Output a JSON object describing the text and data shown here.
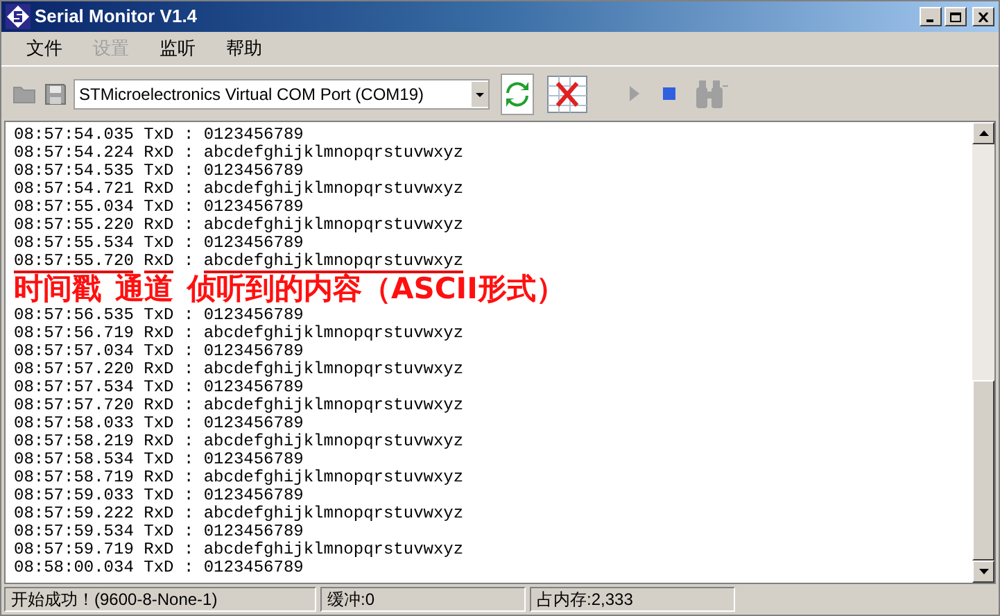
{
  "window": {
    "title": "Serial Monitor V1.4"
  },
  "menu": [
    {
      "label": "文件",
      "disabled": false
    },
    {
      "label": "设置",
      "disabled": true
    },
    {
      "label": "监听",
      "disabled": false
    },
    {
      "label": "帮助",
      "disabled": false
    }
  ],
  "toolbar": {
    "left": [
      {
        "kind": "folder",
        "disabled": true
      },
      {
        "kind": "save",
        "disabled": true
      }
    ],
    "port": {
      "value": "STMicroelectronics Virtual COM Port (COM19)"
    },
    "right": [
      {
        "kind": "refresh",
        "disabled": false
      },
      {
        "kind": "clear",
        "disabled": false
      },
      {
        "kind": "play",
        "disabled": true
      },
      {
        "kind": "stop",
        "disabled": false
      },
      {
        "kind": "binoculars",
        "disabled": true
      }
    ]
  },
  "log": [
    {
      "kind": "line",
      "time": "08:57:54.035",
      "channel": "TxD",
      "sep": ":",
      "content": "0123456789",
      "underlined": false
    },
    {
      "kind": "line",
      "time": "08:57:54.224",
      "channel": "RxD",
      "sep": ":",
      "content": "abcdefghijklmnopqrstuvwxyz",
      "underlined": false
    },
    {
      "kind": "line",
      "time": "08:57:54.535",
      "channel": "TxD",
      "sep": ":",
      "content": "0123456789",
      "underlined": false
    },
    {
      "kind": "line",
      "time": "08:57:54.721",
      "channel": "RxD",
      "sep": ":",
      "content": "abcdefghijklmnopqrstuvwxyz",
      "underlined": false
    },
    {
      "kind": "line",
      "time": "08:57:55.034",
      "channel": "TxD",
      "sep": ":",
      "content": "0123456789",
      "underlined": false
    },
    {
      "kind": "line",
      "time": "08:57:55.220",
      "channel": "RxD",
      "sep": ":",
      "content": "abcdefghijklmnopqrstuvwxyz",
      "underlined": false
    },
    {
      "kind": "line",
      "time": "08:57:55.534",
      "channel": "TxD",
      "sep": ":",
      "content": "0123456789",
      "underlined": false
    },
    {
      "kind": "line",
      "time": "08:57:55.720",
      "channel": "RxD",
      "sep": ":",
      "content": "abcdefghijklmnopqrstuvwxyz",
      "underlined": true
    },
    {
      "kind": "annotation",
      "parts": [
        "时间戳",
        "通道",
        "侦听到的内容（ASCII形式）"
      ]
    },
    {
      "kind": "line",
      "time": "08:57:56.535",
      "channel": "TxD",
      "sep": ":",
      "content": "0123456789",
      "underlined": false
    },
    {
      "kind": "line",
      "time": "08:57:56.719",
      "channel": "RxD",
      "sep": ":",
      "content": "abcdefghijklmnopqrstuvwxyz",
      "underlined": false
    },
    {
      "kind": "line",
      "time": "08:57:57.034",
      "channel": "TxD",
      "sep": ":",
      "content": "0123456789",
      "underlined": false
    },
    {
      "kind": "line",
      "time": "08:57:57.220",
      "channel": "RxD",
      "sep": ":",
      "content": "abcdefghijklmnopqrstuvwxyz",
      "underlined": false
    },
    {
      "kind": "line",
      "time": "08:57:57.534",
      "channel": "TxD",
      "sep": ":",
      "content": "0123456789",
      "underlined": false
    },
    {
      "kind": "line",
      "time": "08:57:57.720",
      "channel": "RxD",
      "sep": ":",
      "content": "abcdefghijklmnopqrstuvwxyz",
      "underlined": false
    },
    {
      "kind": "line",
      "time": "08:57:58.033",
      "channel": "TxD",
      "sep": ":",
      "content": "0123456789",
      "underlined": false
    },
    {
      "kind": "line",
      "time": "08:57:58.219",
      "channel": "RxD",
      "sep": ":",
      "content": "abcdefghijklmnopqrstuvwxyz",
      "underlined": false
    },
    {
      "kind": "line",
      "time": "08:57:58.534",
      "channel": "TxD",
      "sep": ":",
      "content": "0123456789",
      "underlined": false
    },
    {
      "kind": "line",
      "time": "08:57:58.719",
      "channel": "RxD",
      "sep": ":",
      "content": "abcdefghijklmnopqrstuvwxyz",
      "underlined": false
    },
    {
      "kind": "line",
      "time": "08:57:59.033",
      "channel": "TxD",
      "sep": ":",
      "content": "0123456789",
      "underlined": false
    },
    {
      "kind": "line",
      "time": "08:57:59.222",
      "channel": "RxD",
      "sep": ":",
      "content": "abcdefghijklmnopqrstuvwxyz",
      "underlined": false
    },
    {
      "kind": "line",
      "time": "08:57:59.534",
      "channel": "TxD",
      "sep": ":",
      "content": "0123456789",
      "underlined": false
    },
    {
      "kind": "line",
      "time": "08:57:59.719",
      "channel": "RxD",
      "sep": ":",
      "content": "abcdefghijklmnopqrstuvwxyz",
      "underlined": false
    },
    {
      "kind": "line",
      "time": "08:58:00.034",
      "channel": "TxD",
      "sep": ":",
      "content": "0123456789",
      "underlined": false
    }
  ],
  "status_bar": [
    "开始成功！(9600-8-None-1)",
    "缓冲:0",
    "占内存:2,333"
  ]
}
